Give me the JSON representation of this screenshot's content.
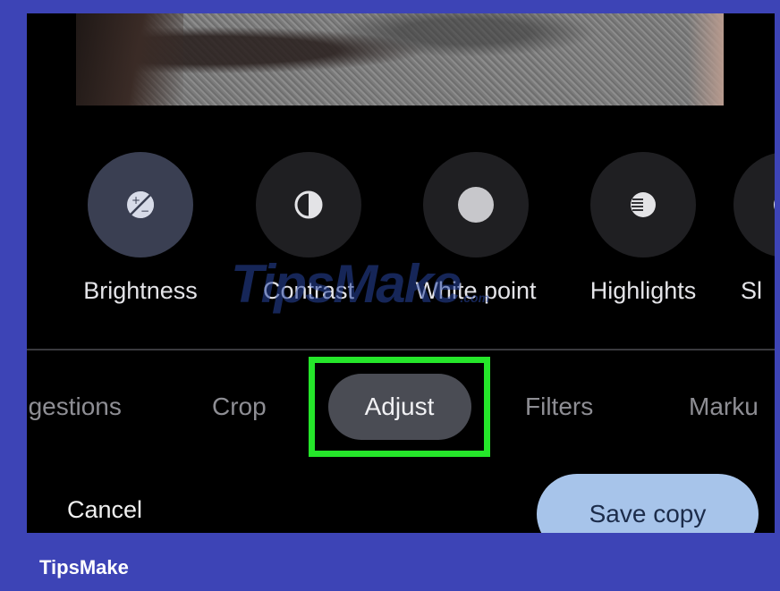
{
  "tools": [
    {
      "label": "Brightness",
      "icon": "brightness-icon"
    },
    {
      "label": "Contrast",
      "icon": "contrast-icon"
    },
    {
      "label": "White point",
      "icon": "white-point-icon"
    },
    {
      "label": "Highlights",
      "icon": "highlights-icon"
    },
    {
      "label": "Sl",
      "icon": "shadows-icon"
    }
  ],
  "tabs": [
    {
      "label": "ggestions"
    },
    {
      "label": "Crop"
    },
    {
      "label": "Adjust"
    },
    {
      "label": "Filters"
    },
    {
      "label": "Marku"
    }
  ],
  "actions": {
    "cancel_label": "Cancel",
    "save_label": "Save copy"
  },
  "watermark": {
    "text": "TipsMake",
    "suffix": ".com"
  },
  "footer": {
    "brand": "TipsMake"
  },
  "colors": {
    "frame": "#3d44b6",
    "highlight_border": "#25e62a",
    "save_button": "#a7c4ea"
  }
}
